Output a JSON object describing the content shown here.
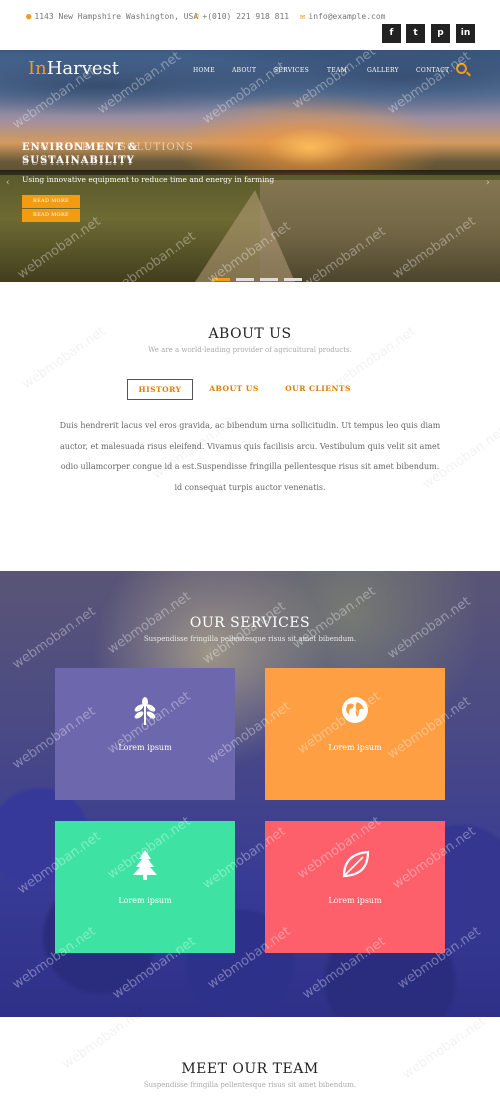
{
  "topbar": {
    "address": "1143 New Hampshire Washington, USA",
    "phone": "+(010) 221 918 811",
    "email": "info@example.com",
    "social": [
      {
        "label": "f",
        "icon": "facebook-icon"
      },
      {
        "label": "t",
        "icon": "twitter-icon"
      },
      {
        "label": "p",
        "icon": "pinterest-icon"
      },
      {
        "label": "in",
        "icon": "linkedin-icon"
      }
    ]
  },
  "brand": {
    "prefix": "In",
    "name": "Harvest"
  },
  "nav": [
    "HOME",
    "ABOUT",
    "SERVICES",
    "TEAM",
    "GALLERY",
    "CONTACT"
  ],
  "hero": {
    "heading_a": "ENVIRONMENT &",
    "heading_b": "ENGINEERING SOLUTIONS",
    "heading_c": "SUSTAINABILITY",
    "heading_d": "SUSTAINABILITY",
    "subtitle": "Using innovative equipment to reduce time and energy in farming",
    "button": "READ MORE",
    "button2": "READ MORE",
    "prev": "‹",
    "next": "›",
    "slides": 4,
    "active_slide": 1
  },
  "about": {
    "title": "ABOUT US",
    "subtitle": "We are a world-leading provider of agricultural products.",
    "tabs": [
      {
        "label": "HISTORY",
        "active": true
      },
      {
        "label": "ABOUT US",
        "active": false
      },
      {
        "label": "OUR CLIENTS",
        "active": false
      }
    ],
    "text": "Duis hendrerit lacus vel eros gravida, ac bibendum urna sollicitudin. Ut tempus leo quis diam auctor, et malesuada risus eleifend. Vivamus quis facilisis arcu. Vestibulum quis velit sit amet odio ullamcorper congue id a est.Suspendisse fringilla pellentesque risus sit amet bibendum. id consequat turpis auctor venenatis."
  },
  "services": {
    "title": "OUR SERVICES",
    "subtitle": "Suspendisse fringilla pellentesque risus sit amet bibendum.",
    "cards": [
      {
        "label": "Lorem ipsum",
        "icon": "leaf-branch-icon",
        "color": "#6d67ad"
      },
      {
        "label": "Lorem ipsum",
        "icon": "globe-icon",
        "color": "#ff9f43"
      },
      {
        "label": "Lorem ipsum",
        "icon": "pine-tree-icon",
        "color": "#3ee3a3"
      },
      {
        "label": "Lorem ipsum",
        "icon": "leaf-icon",
        "color": "#fd5f6b"
      }
    ]
  },
  "team": {
    "title": "MEET OUR TEAM",
    "subtitle": "Suspendisse fringilla pellentesque risus sit amet bibendum."
  },
  "watermark": "webmoban.net",
  "colors": {
    "accent": "#f39c12"
  }
}
